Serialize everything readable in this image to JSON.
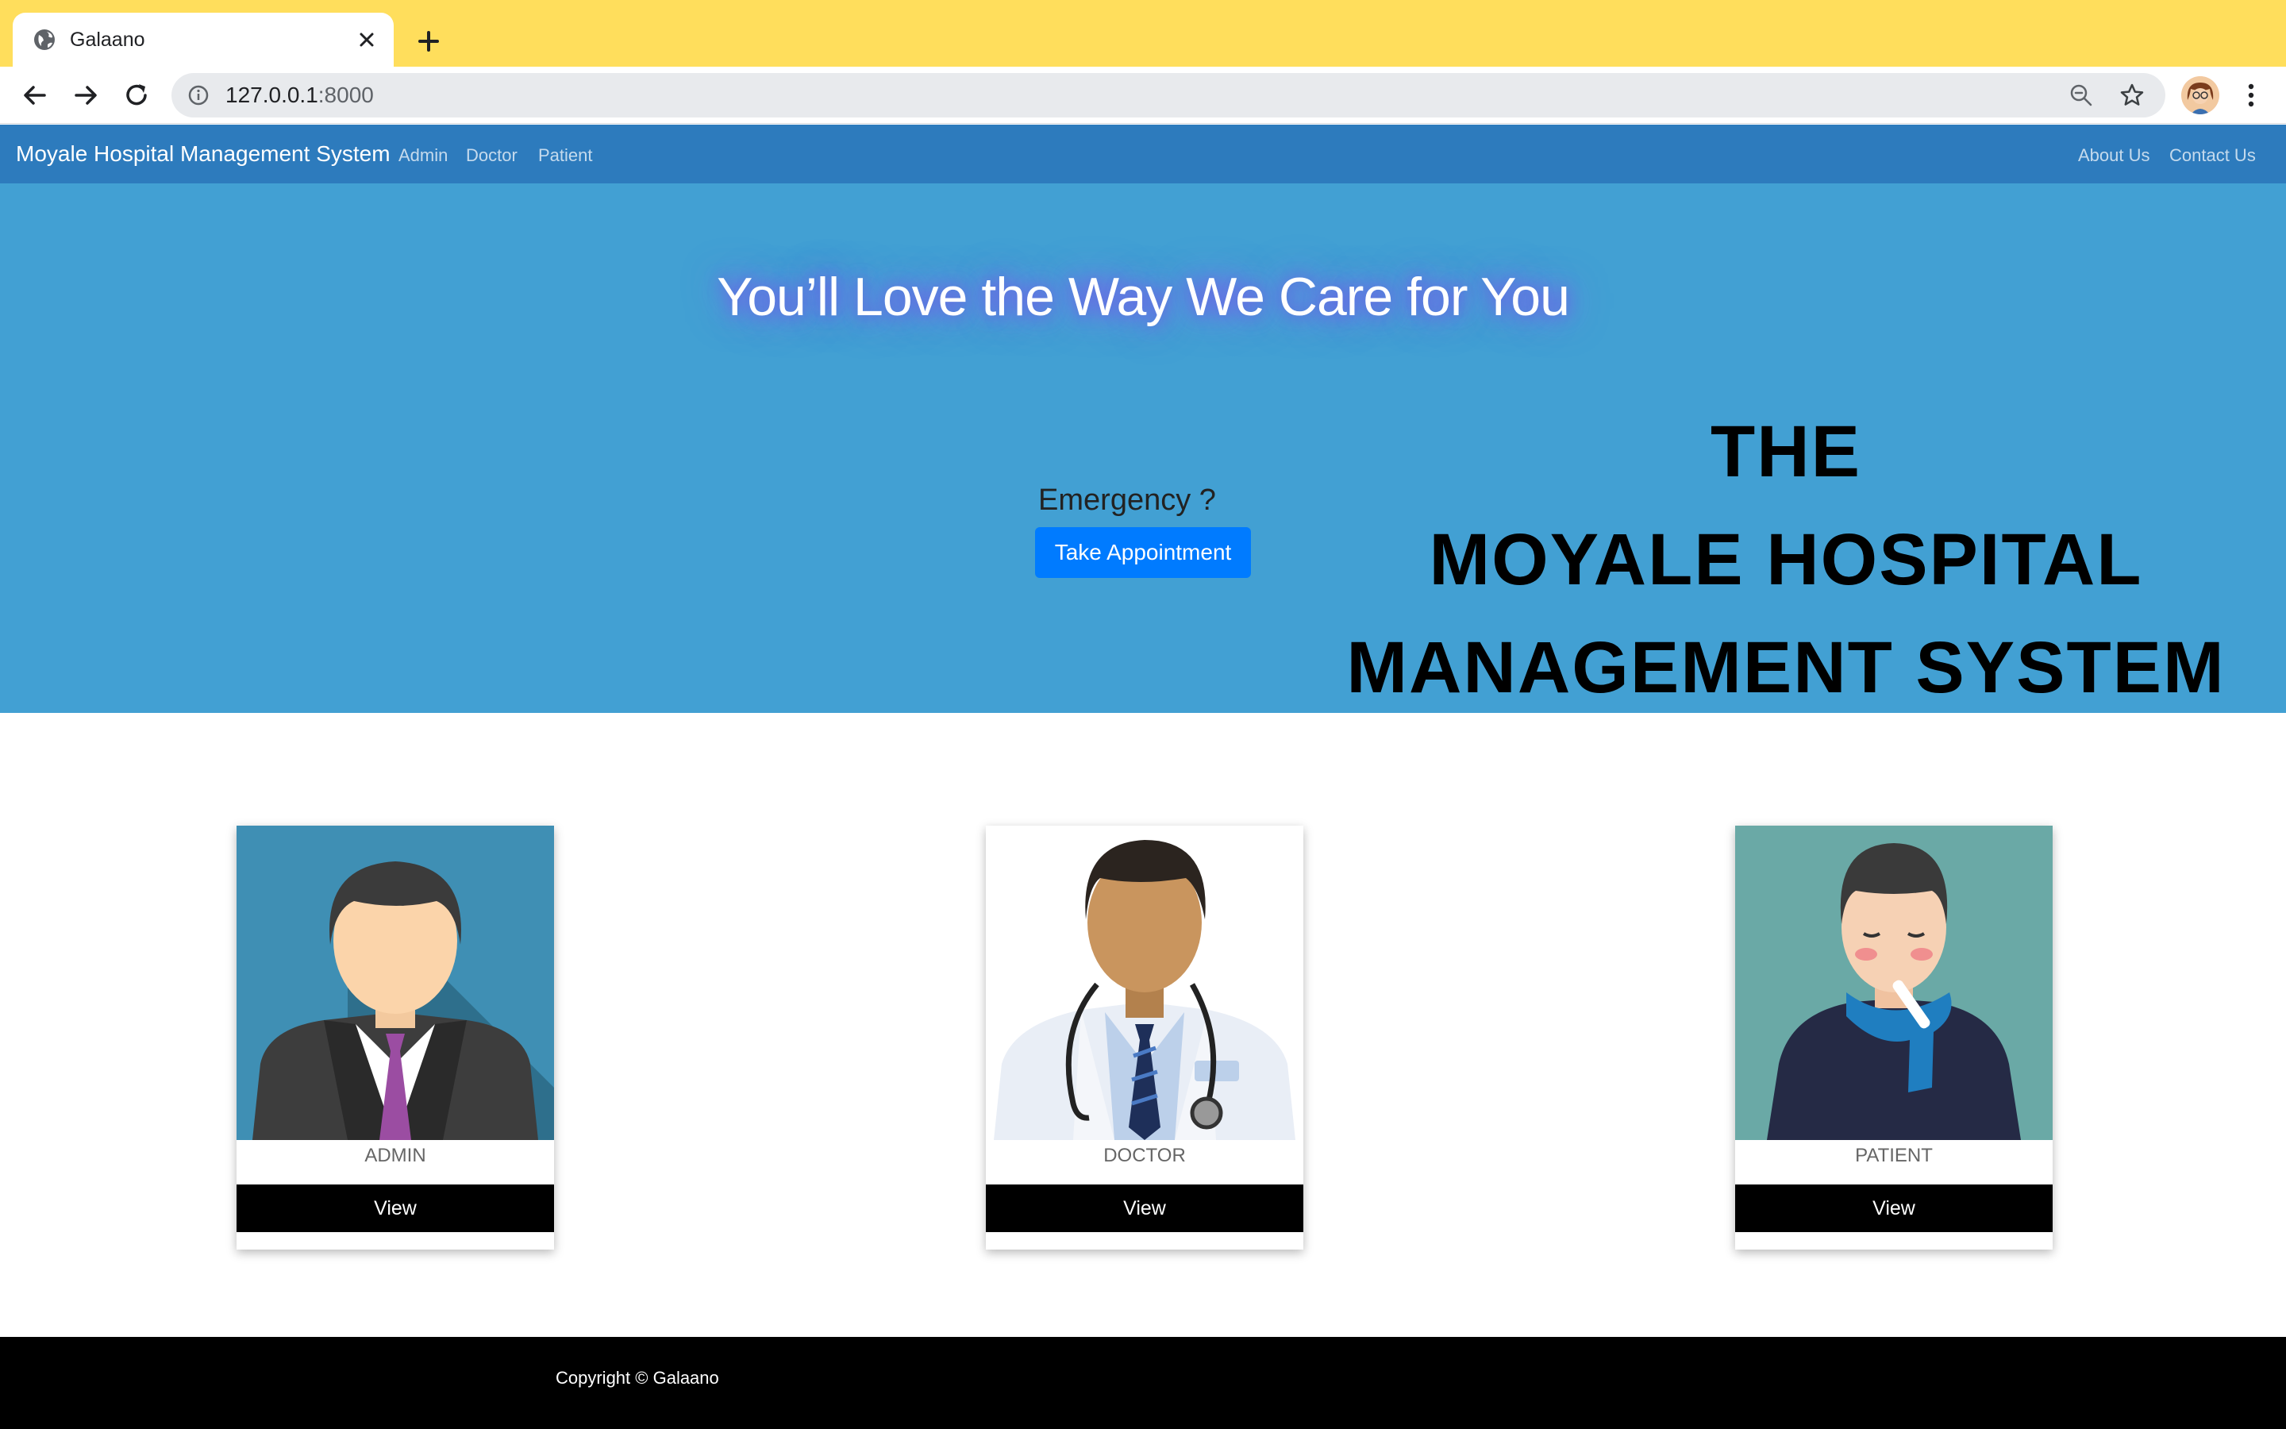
{
  "browser": {
    "tab_title": "Galaano",
    "url_host": "127.0.0.1",
    "url_port": ":8000",
    "icons": [
      "globe-icon",
      "close-icon",
      "plus-icon",
      "back-arrow-icon",
      "forward-arrow-icon",
      "reload-icon",
      "info-icon",
      "zoom-icon",
      "star-icon",
      "profile-avatar",
      "menu-dots-icon"
    ]
  },
  "navbar": {
    "brand": "Moyale Hospital Management System",
    "left_links": [
      "Admin",
      "Doctor",
      "Patient"
    ],
    "right_links": [
      "About Us",
      "Contact Us"
    ],
    "color": "#2d7bbd"
  },
  "hero": {
    "tagline": "You’ll Love the Way We Care for You",
    "title_lines": [
      "THE",
      "MOYALE HOSPITAL",
      "MANAGEMENT SYSTEM"
    ],
    "emergency": "Emergency ?",
    "appointment_button": "Take Appointment",
    "background": "#42a0d3",
    "button_color": "#007bff"
  },
  "cards": [
    {
      "label": "ADMIN",
      "button": "View"
    },
    {
      "label": "DOCTOR",
      "button": "View"
    },
    {
      "label": "PATIENT",
      "button": "View"
    }
  ],
  "footer": {
    "copyright": "Copyright © Galaano"
  }
}
